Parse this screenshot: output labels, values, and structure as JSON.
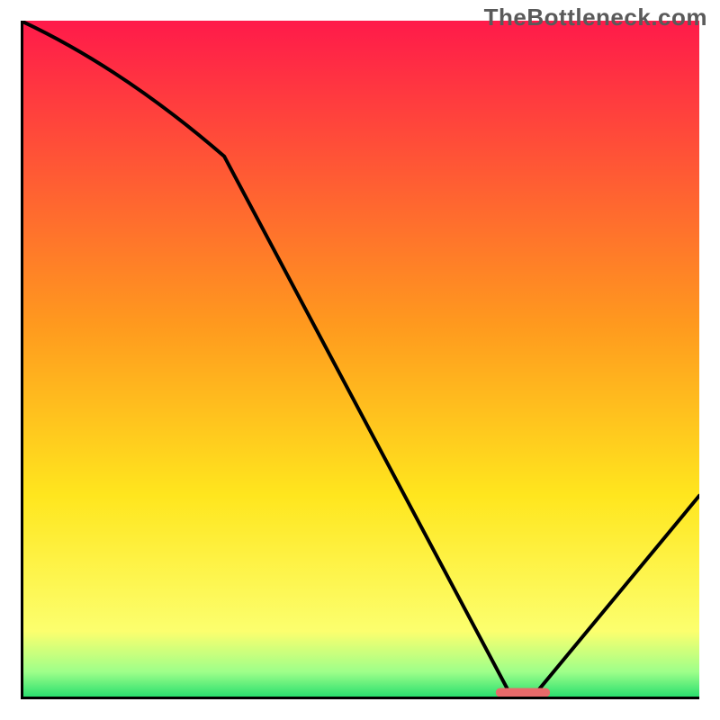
{
  "watermark": "TheBottleneck.com",
  "colors": {
    "top": "#ff1a4a",
    "mid1": "#ff9a1e",
    "mid2": "#ffe61e",
    "bottom_yellow": "#fcff6e",
    "green_light": "#9dff8a",
    "green_dark": "#1edb6b",
    "line": "#000000",
    "marker": "#e86a6a",
    "axis": "#000000"
  },
  "chart_data": {
    "type": "line",
    "title": "",
    "xlabel": "",
    "ylabel": "",
    "xlim": [
      0,
      100
    ],
    "ylim": [
      0,
      100
    ],
    "x": [
      0,
      30,
      72,
      76,
      100
    ],
    "values": [
      100,
      80,
      1,
      1,
      30
    ],
    "marker": {
      "x_start": 70,
      "x_end": 78,
      "y": 1
    }
  }
}
